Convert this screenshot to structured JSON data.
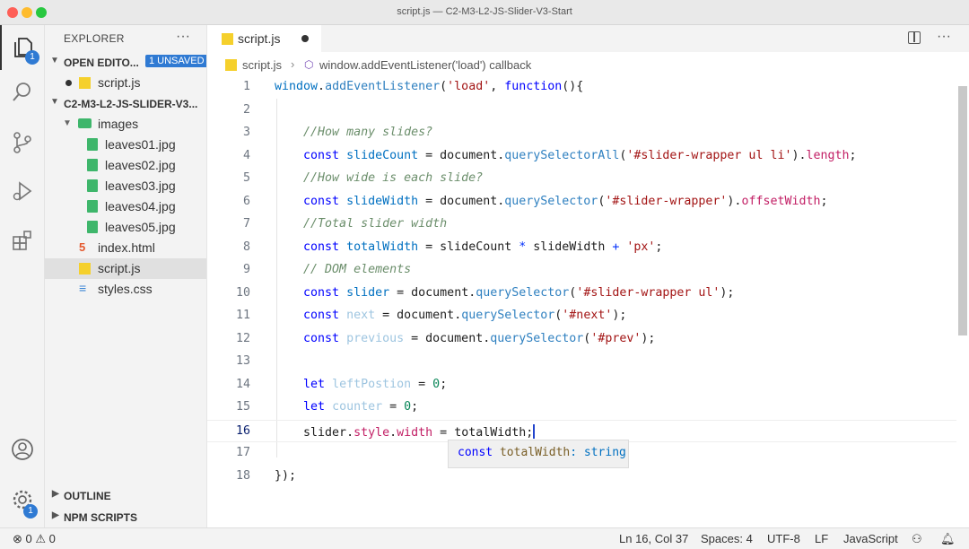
{
  "window": {
    "title": "script.js — C2-M3-L2-JS-Slider-V3-Start"
  },
  "activity": {
    "explorer_badge": "1",
    "settings_badge": "1"
  },
  "sidebar": {
    "title": "EXPLORER",
    "more": "···",
    "open_editors": {
      "label": "OPEN EDITO...",
      "badge": "1 UNSAVED",
      "files": [
        "script.js"
      ]
    },
    "project": {
      "label": "C2-M3-L2-JS-SLIDER-V3...",
      "folder": "images",
      "images": [
        "leaves01.jpg",
        "leaves02.jpg",
        "leaves03.jpg",
        "leaves04.jpg",
        "leaves05.jpg"
      ],
      "files": [
        "index.html",
        "script.js",
        "styles.css"
      ]
    },
    "outline": "OUTLINE",
    "npm": "NPM SCRIPTS"
  },
  "editor": {
    "tab": "script.js",
    "more": "···",
    "breadcrumb": {
      "file": "script.js",
      "symbol": "window.addEventListener('load') callback"
    },
    "line_numbers": [
      "1",
      "2",
      "3",
      "4",
      "5",
      "6",
      "7",
      "8",
      "9",
      "10",
      "11",
      "12",
      "13",
      "14",
      "15",
      "16",
      "17",
      "18"
    ],
    "hover": {
      "keyword": "const",
      "name": "totalWidth",
      "type": ": string"
    }
  },
  "code": {
    "l1": {
      "obj": "window",
      "method": "addEventListener",
      "str": "'load'",
      "fn": "function"
    },
    "c3": "//How many slides?",
    "l4": {
      "name": "slideCount",
      "method": "querySelectorAll",
      "str": "'#slider-wrapper ul li'",
      "prop": "length"
    },
    "c5": "//How wide is each slide?",
    "l6": {
      "name": "slideWidth",
      "method": "querySelector",
      "str": "'#slider-wrapper'",
      "prop": "offsetWidth"
    },
    "c7": "//Total slider width",
    "l8": {
      "name": "totalWidth",
      "a": "slideCount",
      "b": "slideWidth",
      "str": "'px'"
    },
    "c9": "// DOM elements",
    "l10": {
      "name": "slider",
      "str": "'#slider-wrapper ul'"
    },
    "l11": {
      "name": "next",
      "str": "'#next'"
    },
    "l12": {
      "name": "previous",
      "str": "'#prev'"
    },
    "l14": {
      "name": "leftPostion",
      "num": "0"
    },
    "l15": {
      "name": "counter",
      "num": "0"
    },
    "l16": {
      "obj": "slider",
      "p1": "style",
      "p2": "width",
      "val": "totalWidth"
    },
    "l18": "});",
    "kw_const": "const",
    "kw_let": "let",
    "document": "document",
    "querySelector": "querySelector"
  },
  "status": {
    "problems": "0",
    "warnings": "0",
    "position": "Ln 16, Col 37",
    "spaces": "Spaces: 4",
    "encoding": "UTF-8",
    "eol": "LF",
    "language": "JavaScript"
  }
}
